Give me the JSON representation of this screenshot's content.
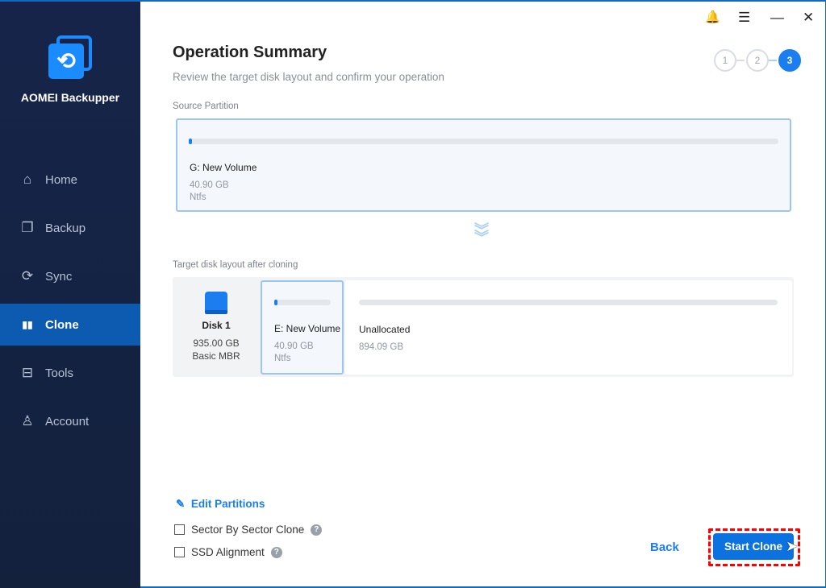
{
  "app": {
    "name": "AOMEI Backupper"
  },
  "sidebar": {
    "items": [
      {
        "label": "Home",
        "icon": "home-icon",
        "glyph": "⌂"
      },
      {
        "label": "Backup",
        "icon": "backup-icon",
        "glyph": "❐"
      },
      {
        "label": "Sync",
        "icon": "sync-icon",
        "glyph": "⟳"
      },
      {
        "label": "Clone",
        "icon": "clone-icon",
        "glyph": "▮▮",
        "active": true
      },
      {
        "label": "Tools",
        "icon": "tools-icon",
        "glyph": "⊟"
      },
      {
        "label": "Account",
        "icon": "account-icon",
        "glyph": "♙"
      }
    ]
  },
  "titlebar": {
    "bell": "🔔",
    "menu": "☰",
    "minimize": "—",
    "close": "✕"
  },
  "header": {
    "title": "Operation Summary",
    "subtitle": "Review the target disk layout and confirm your operation",
    "steps": [
      "1",
      "2",
      "3"
    ],
    "current_step": 3
  },
  "source": {
    "label": "Source Partition",
    "name": "G: New Volume",
    "size": "40.90 GB",
    "fs": "Ntfs",
    "used_fraction": 0.005
  },
  "target": {
    "label": "Target disk layout after cloning",
    "disk": {
      "name": "Disk 1",
      "size": "935.00 GB",
      "type": "Basic MBR"
    },
    "partitions": [
      {
        "name": "E: New Volume",
        "size": "40.90 GB",
        "fs": "Ntfs",
        "selected": true
      },
      {
        "name": "Unallocated",
        "size": "894.09 GB"
      }
    ]
  },
  "options": {
    "edit_partitions": "Edit Partitions",
    "sector_by_sector": "Sector By Sector Clone",
    "ssd_alignment": "SSD Alignment",
    "help": "?"
  },
  "footer": {
    "back": "Back",
    "start": "Start Clone"
  },
  "colors": {
    "accent": "#1a7ef0",
    "sidebar": "#16244a",
    "active": "#0d5bb0",
    "highlight": "#ff0000"
  }
}
